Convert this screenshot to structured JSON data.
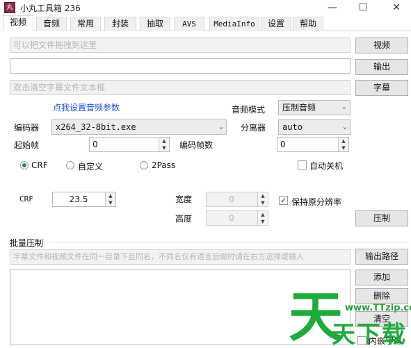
{
  "window": {
    "title": "小丸工具箱 236",
    "icon_text": "丸"
  },
  "tabs": [
    "视频",
    "音频",
    "常用",
    "封装",
    "抽取",
    "AVS",
    "MediaInfo",
    "设置",
    "帮助"
  ],
  "video": {
    "input_placeholder": "可以把文件拖拽到这里",
    "video_button": "视频",
    "output_value": "",
    "output_button": "输出",
    "subtitle_placeholder": "双击清空字幕文件文本框",
    "subtitle_button": "字幕",
    "audio_link": "点我设置音频参数",
    "audio_mode_label": "音频模式",
    "audio_mode_value": "压制音频",
    "encoder_label": "编码器",
    "encoder_value": "x264_32-8bit.exe",
    "splitter_label": "分离器",
    "splitter_value": "auto",
    "start_frame_label": "起始帧",
    "start_frame_value": "0",
    "encode_frames_label": "编码帧数",
    "encode_frames_value": "0",
    "rate_modes": [
      "CRF",
      "自定义",
      "2Pass"
    ],
    "rate_mode_selected": "CRF",
    "auto_shutdown_label": "自动关机",
    "auto_shutdown_checked": false,
    "crf_label": "CRF",
    "crf_value": "23.5",
    "width_label": "宽度",
    "width_value": "0",
    "height_label": "高度",
    "height_value": "0",
    "keep_resolution_label": "保持原分辨率",
    "keep_resolution_checked": true,
    "compress_button": "压制"
  },
  "batch": {
    "group_title": "批量压制",
    "hint": "字幕文件和视频文件在同一目录下且同名，不同名仅有语言后缀时请在右方选择或输入",
    "output_path_button": "输出路径",
    "add_button": "添加",
    "delete_button": "删除",
    "clear_button": "清空",
    "embed_subtitle_label": "内嵌字幕"
  },
  "watermark": {
    "big": "天",
    "url": "www.TTzip.com",
    "small": "天下载"
  }
}
